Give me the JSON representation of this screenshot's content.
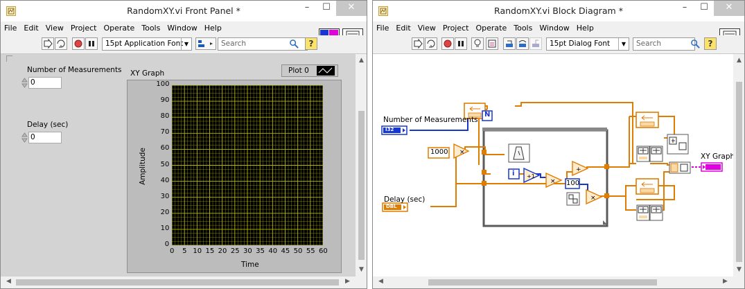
{
  "front_panel": {
    "title": "RandomXY.vi Front Panel *",
    "window_controls": {
      "minimize": "–",
      "maximize": "☐",
      "close": "✕"
    },
    "menu": [
      "File",
      "Edit",
      "View",
      "Project",
      "Operate",
      "Tools",
      "Window",
      "Help"
    ],
    "toolbar": {
      "font": "15pt Application Font",
      "search_placeholder": "Search"
    },
    "controls": {
      "measurements_label": "Number of Measurements",
      "measurements_value": "0",
      "delay_label": "Delay (sec)",
      "delay_value": "0"
    },
    "graph": {
      "label": "XY Graph",
      "legend": "Plot 0",
      "xlabel": "Time",
      "ylabel": "Amplitude"
    },
    "chart_data": {
      "type": "line",
      "title": "XY Graph",
      "xlabel": "Time",
      "ylabel": "Amplitude",
      "xlim": [
        0,
        60
      ],
      "ylim": [
        0,
        100
      ],
      "x_ticks": [
        "0",
        "5",
        "10",
        "15",
        "20",
        "25",
        "30",
        "35",
        "40",
        "45",
        "50",
        "55",
        "60"
      ],
      "y_ticks": [
        "0",
        "10",
        "20",
        "30",
        "40",
        "50",
        "60",
        "70",
        "80",
        "90",
        "100"
      ],
      "grid": true,
      "legend": "top-right",
      "series": [
        {
          "name": "Plot 0",
          "x": [],
          "y": []
        }
      ],
      "colors": {
        "plot_bg": "#000000",
        "grid": "#b8b800",
        "frame": "#bcbcbc"
      }
    }
  },
  "block_diagram": {
    "title": "RandomXY.vi Block Diagram *",
    "window_controls": {
      "minimize": "–",
      "maximize": "☐",
      "close": "✕"
    },
    "menu": [
      "File",
      "Edit",
      "View",
      "Project",
      "Operate",
      "Tools",
      "Window",
      "Help"
    ],
    "toolbar": {
      "font": "15pt Dialog Font",
      "search_placeholder": "Search"
    },
    "terminals": {
      "measurements_label": "Number of Measurements",
      "measurements_type": "I32",
      "delay_label": "Delay (sec)",
      "delay_type": "DBL",
      "graph_label": "XY Graph",
      "loop_count": "N",
      "const_1000": "1000",
      "const_100": "100",
      "index": "i"
    },
    "colors": {
      "orange": "#e07c00",
      "blue": "#1636cc",
      "pink": "#e000e0"
    }
  }
}
